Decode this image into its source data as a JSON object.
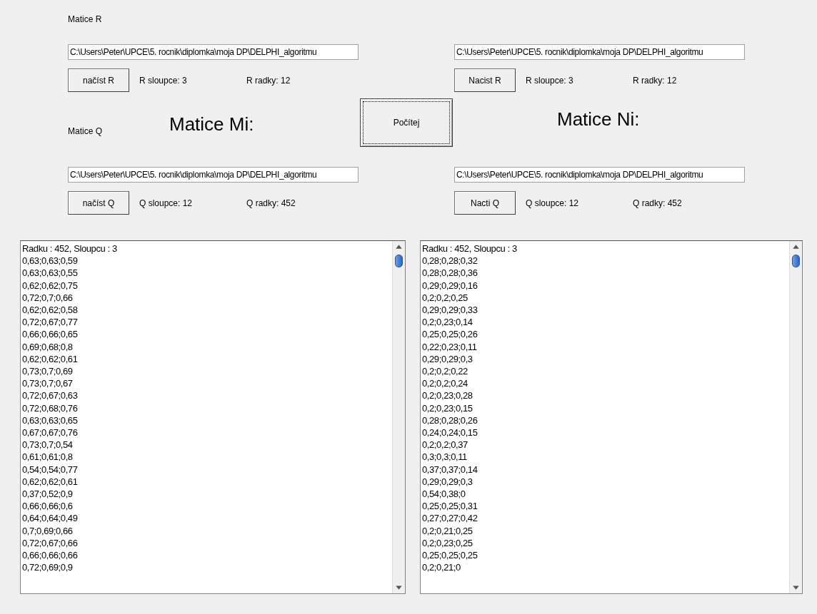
{
  "left_panel": {
    "r_label": "Matice R",
    "r_path": "C:\\Users\\Peter\\UPCE\\5. rocnik\\diplomka\\moja DP\\DELPHI_algoritmu",
    "r_button": "načíst R",
    "r_columns": "R sloupce: 3",
    "r_rows": "R radky: 12",
    "heading": "Matice Mi:",
    "q_label": "Matice Q",
    "q_path": "C:\\Users\\Peter\\UPCE\\5. rocnik\\diplomka\\moja DP\\DELPHI_algoritmu",
    "q_button": "načíst Q",
    "q_columns": "Q sloupce: 12",
    "q_rows": "Q radky: 452",
    "output": [
      "Radku : 452, Sloupcu : 3",
      "0,63;0,63;0,59",
      "0,63;0,63;0,55",
      "0,62;0,62;0,75",
      "0,72;0,7;0,66",
      "0,62;0,62;0,58",
      "0,72;0,67;0,77",
      "0,66;0,66;0,65",
      "0,69;0,68;0,8",
      "0,62;0,62;0,61",
      "0,73;0,7;0,69",
      "0,73;0,7;0,67",
      "0,72;0,67;0,63",
      "0,72;0,68;0,76",
      "0,63;0,63;0,65",
      "0,67;0,67;0,76",
      "0,73;0,7;0,54",
      "0,61;0,61;0,8",
      "0,54;0,54;0,77",
      "0,62;0,62;0,61",
      "0,37;0,52;0,9",
      "0,66;0,66;0,6",
      "0,64;0,64;0,49",
      "0,7;0,69;0,66",
      "0,72;0,67;0,66",
      "0,66;0,66;0,66",
      "0,72;0,69;0,9"
    ]
  },
  "compute_button": "Počítej",
  "right_panel": {
    "r_path": "C:\\Users\\Peter\\UPCE\\5. rocnik\\diplomka\\moja DP\\DELPHI_algoritmu",
    "r_button": "Nacist R",
    "r_columns": "R sloupce: 3",
    "r_rows": "R radky: 12",
    "heading": "Matice Ni:",
    "q_path": "C:\\Users\\Peter\\UPCE\\5. rocnik\\diplomka\\moja DP\\DELPHI_algoritmu",
    "q_button": "Nacti Q",
    "q_columns": "Q sloupce: 12",
    "q_rows": "Q radky: 452",
    "output": [
      "Radku : 452, Sloupcu : 3",
      "0,28;0,28;0,32",
      "0,28;0,28;0,36",
      "0,29;0,29;0,16",
      "0,2;0,2;0,25",
      "0,29;0,29;0,33",
      "0,2;0,23;0,14",
      "0,25;0,25;0,26",
      "0,22;0,23;0,11",
      "0,29;0,29;0,3",
      "0,2;0,2;0,22",
      "0,2;0,2;0,24",
      "0,2;0,23;0,28",
      "0,2;0,23;0,15",
      "0,28;0,28;0,26",
      "0,24;0,24;0,15",
      "0,2;0,2;0,37",
      "0,3;0,3;0,11",
      "0,37;0,37;0,14",
      "0,29;0,29;0,3",
      "0,54;0,38;0",
      "0,25;0,25;0,31",
      "0,27;0,27;0,42",
      "0,2;0,21;0,25",
      "0,2;0,23;0,25",
      "0,25;0,25;0,25",
      "0,2;0,21;0"
    ]
  }
}
